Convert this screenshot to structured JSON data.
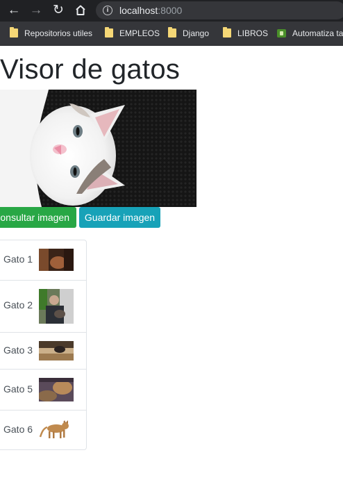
{
  "browser": {
    "url_host": "localhost",
    "url_port": ":8000",
    "bookmarks": [
      {
        "label": "Repositorios utiles",
        "icon": "folder-icon"
      },
      {
        "label": "EMPLEOS",
        "icon": "folder-icon"
      },
      {
        "label": "Django",
        "icon": "folder-icon"
      },
      {
        "label": "LIBROS",
        "icon": "folder-icon"
      },
      {
        "label": "Automatiza ta",
        "icon": "site-favicon-icon"
      }
    ]
  },
  "page": {
    "title": "Visor de gatos",
    "buttons": {
      "consultar": "Consultar imagen",
      "guardar": "Guardar imagen"
    },
    "cats": [
      {
        "name": "Gato 1"
      },
      {
        "name": "Gato 2"
      },
      {
        "name": "Gato 3"
      },
      {
        "name": "Gato 5"
      },
      {
        "name": "Gato 6"
      }
    ]
  },
  "colors": {
    "success": "#28a745",
    "info": "#17a2b8",
    "chrome_dark": "#202124",
    "bookmarks_bar": "#35363a"
  }
}
